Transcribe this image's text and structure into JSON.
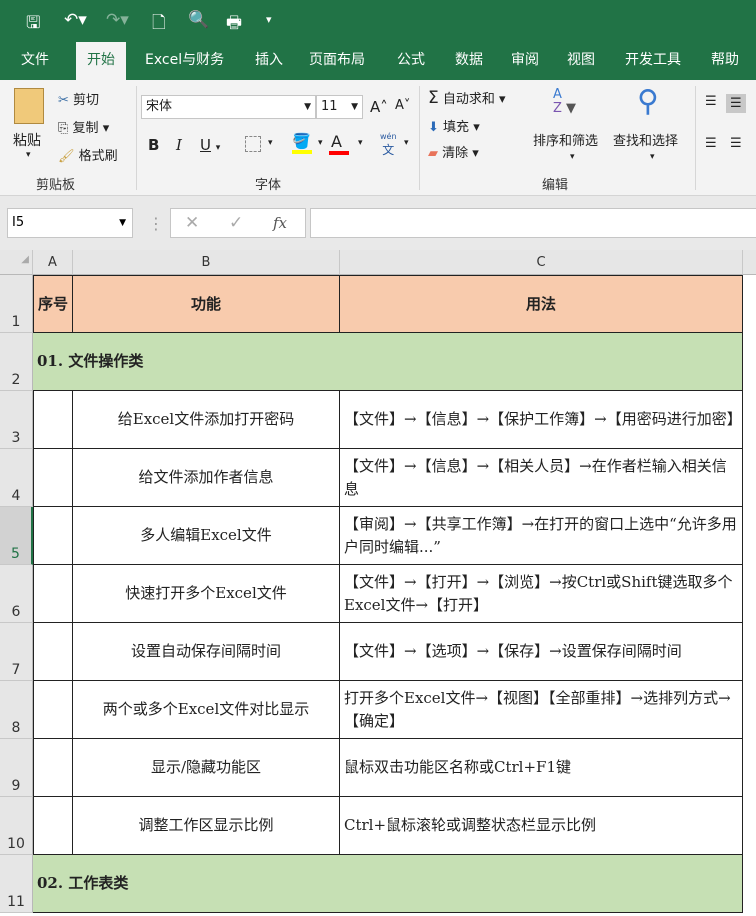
{
  "qat": {
    "save": "save-icon",
    "undo": "undo-icon",
    "redo": "redo-icon",
    "new": "new-file-icon",
    "preview": "print-preview-icon",
    "print": "print-icon",
    "customize": "customize-icon"
  },
  "tabs": [
    "文件",
    "开始",
    "Excel与财务",
    "插入",
    "页面布局",
    "公式",
    "数据",
    "审阅",
    "视图",
    "开发工具",
    "帮助"
  ],
  "active_tab": "开始",
  "ribbon": {
    "clipboard": {
      "paste": "粘贴",
      "cut": "剪切",
      "copy": "复制",
      "format_painter": "格式刷",
      "group": "剪贴板"
    },
    "font": {
      "name": "宋体",
      "size": "11",
      "bold": "B",
      "italic": "I",
      "underline": "U",
      "wen": "wén",
      "wen2": "文",
      "group": "字体",
      "fill_color": "#ffff00",
      "font_color": "#ff0000"
    },
    "editing": {
      "autosum": "自动求和",
      "fill": "填充",
      "clear": "清除",
      "sort": "排序和筛选",
      "find": "查找和选择",
      "group": "编辑"
    }
  },
  "formula_bar": {
    "name_box": "I5",
    "fx": "fx",
    "value": ""
  },
  "columns": [
    "A",
    "B",
    "C"
  ],
  "rows": [
    {
      "n": "1",
      "type": "header",
      "a": "序号",
      "b": "功能",
      "c": "用法"
    },
    {
      "n": "2",
      "type": "section",
      "a": "01. 文件操作类"
    },
    {
      "n": "3",
      "b": "给Excel文件添加打开密码",
      "c": "【文件】→【信息】→【保护工作簿】→【用密码进行加密】"
    },
    {
      "n": "4",
      "b": "给文件添加作者信息",
      "c": "【文件】→【信息】→【相关人员】→在作者栏输入相关信息"
    },
    {
      "n": "5",
      "b": "多人编辑Excel文件",
      "c": "【审阅】→【共享工作簿】→在打开的窗口上选中“允许多用户同时编辑...”"
    },
    {
      "n": "6",
      "b": "快速打开多个Excel文件",
      "c": "【文件】→【打开】→【浏览】→按Ctrl或Shift键选取多个Excel文件→【打开】"
    },
    {
      "n": "7",
      "b": "设置自动保存间隔时间",
      "c": "【文件】→【选项】→【保存】→设置保存间隔时间"
    },
    {
      "n": "8",
      "b": "两个或多个Excel文件对比显示",
      "c": "打开多个Excel文件→【视图】【全部重排】→选排列方式→【确定】"
    },
    {
      "n": "9",
      "b": "显示/隐藏功能区",
      "c": "鼠标双击功能区名称或Ctrl+F1键"
    },
    {
      "n": "10",
      "b": "调整工作区显示比例",
      "c": "Ctrl+鼠标滚轮或调整状态栏显示比例"
    },
    {
      "n": "11",
      "type": "section",
      "a": "02. 工作表类"
    }
  ],
  "selected_row": "5"
}
